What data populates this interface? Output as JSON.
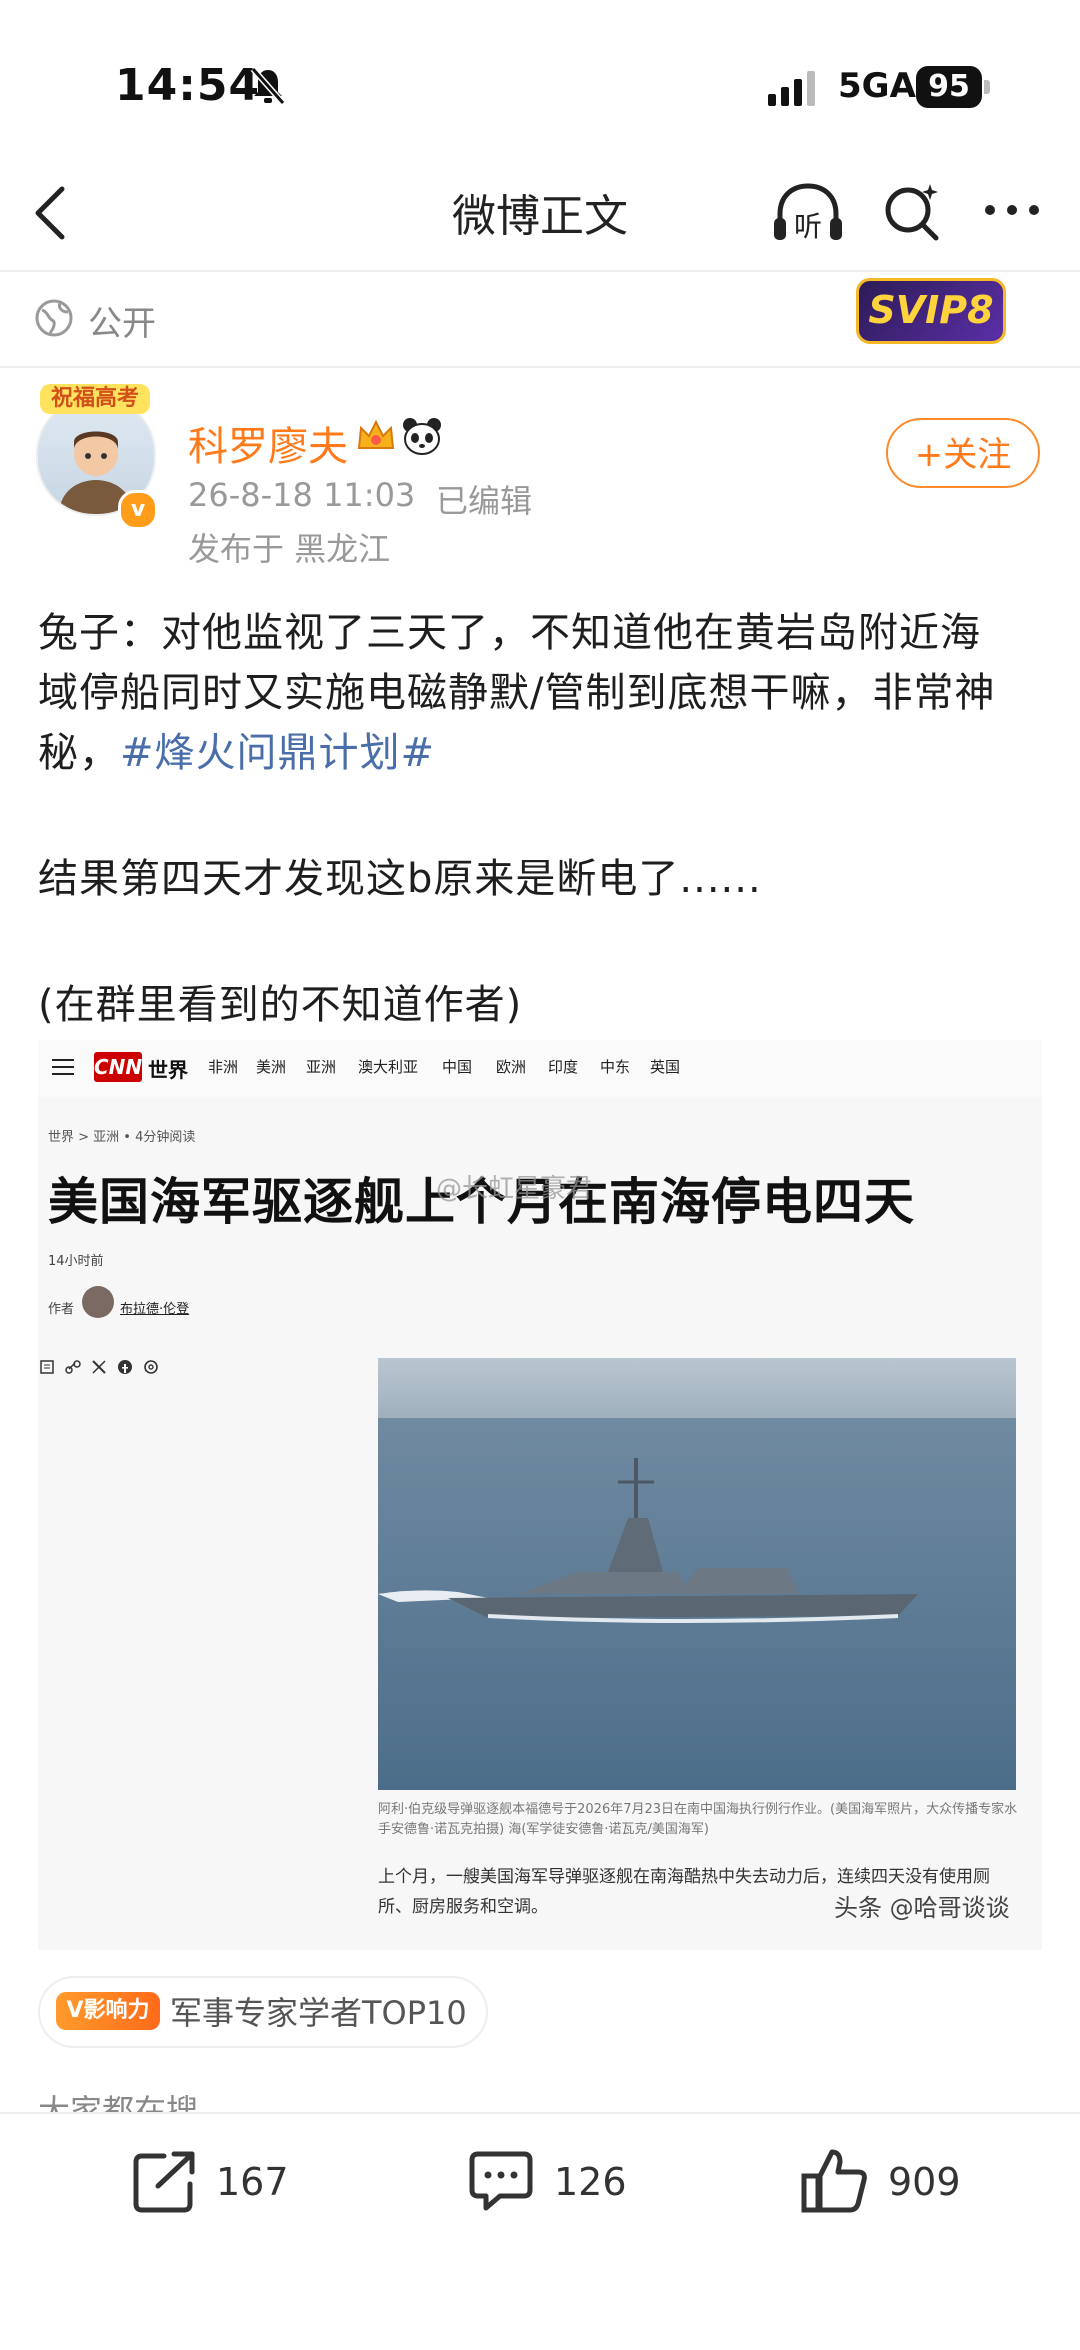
{
  "status_bar": {
    "time": "14:54",
    "network": "5GA",
    "battery": "95"
  },
  "nav": {
    "title": "微博正文",
    "icons": [
      "back-icon",
      "listen-icon",
      "search-icon",
      "more-icon"
    ],
    "listen_label": "听"
  },
  "visibility": {
    "label": "公开",
    "badge": "SVIP8"
  },
  "author": {
    "avatar_tag": "祝福高考",
    "name": "科罗廖夫",
    "time": "26-8-18 11:03",
    "edited": "已编辑",
    "location": "发布于 黑龙江",
    "follow_label": "+关注",
    "verified_mark": "v"
  },
  "post": {
    "line1": "兔子：对他监视了三天了，不知道他在黄岩岛附近海",
    "line2": "域停船同时又实施电磁静默/管制到底想干嘛，非常神",
    "line3_prefix": "秘，",
    "hashtag": "#烽火问鼎计划#",
    "line4": "结果第四天才发现这b原来是断电了......",
    "line5": "(在群里看到的不知道作者)"
  },
  "embed": {
    "cnn_logo": "CNN",
    "section": "世界",
    "nav_items": [
      "非洲",
      "美洲",
      "亚洲",
      "澳大利亚",
      "中国",
      "欧洲",
      "印度",
      "中东",
      "英国"
    ],
    "breadcrumb": "世界 > 亚洲 • 4分钟阅读",
    "headline": "美国海军驱逐舰上个月在南海停电四天",
    "watermark": "@长虹星豪君",
    "timestamp": "14小时前",
    "author_label": "作者",
    "author_name": "布拉德·伦登",
    "caption": "阿利·伯克级导弹驱逐舰本福德号于2026年7月23日在南中国海执行例行作业。(美国海军照片，大众传播专家水手安德鲁·诺瓦克拍摄) 海(军学徒安德鲁·诺瓦克/美国海军)",
    "paragraph": "上个月，一艘美国海军导弹驱逐舰在南海酷热中失去动力后，连续四天没有使用厕所、厨房服务和空调。",
    "source_watermark": "头条 @哈哥谈谈"
  },
  "influence": {
    "icon_label": "V影响力",
    "text": "军事专家学者TOP10"
  },
  "trending": {
    "label": "大家都在搜"
  },
  "actions": {
    "repost_count": "167",
    "comment_count": "126",
    "like_count": "909"
  },
  "colors": {
    "accent": "#ff7a1a",
    "hashtag": "#4a6ea9",
    "muted": "#999999"
  }
}
